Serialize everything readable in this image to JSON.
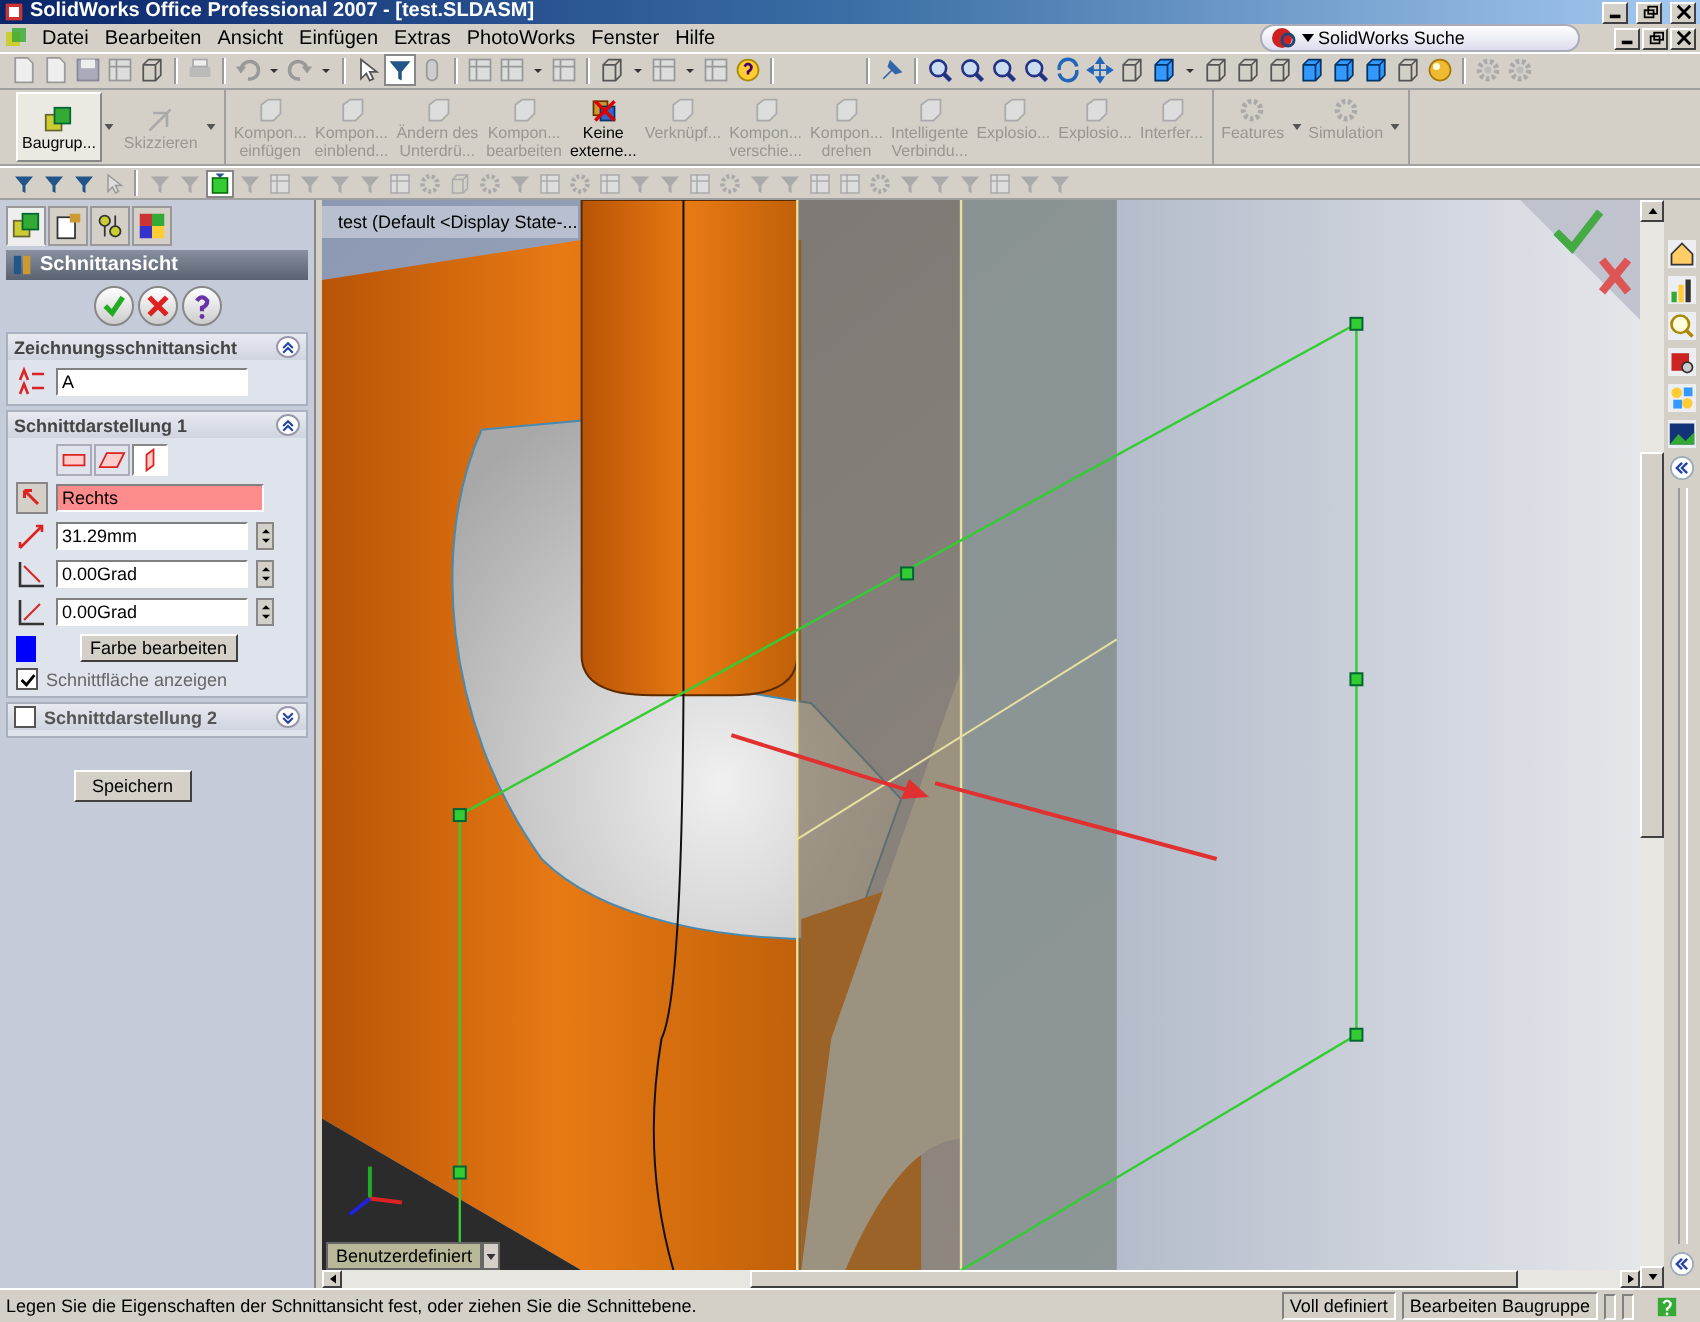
{
  "window": {
    "title": "SolidWorks Office Professional 2007 - [test.SLDASM]"
  },
  "menu": [
    "Datei",
    "Bearbeiten",
    "Ansicht",
    "Einfügen",
    "Extras",
    "PhotoWorks",
    "Fenster",
    "Hilfe"
  ],
  "search": {
    "placeholder": "SolidWorks Suche"
  },
  "command_manager": {
    "modes": [
      {
        "lines": [
          "Baugrup..."
        ],
        "disabled": false,
        "selected": true
      },
      {
        "lines": [
          "Skizzieren"
        ],
        "disabled": true,
        "selected": false
      }
    ],
    "tools": [
      {
        "lines": [
          "Kompon...",
          "einfügen"
        ],
        "disabled": true
      },
      {
        "lines": [
          "Kompon...",
          "einblend..."
        ],
        "disabled": true
      },
      {
        "lines": [
          "Ändern des",
          "Unterdrü..."
        ],
        "disabled": true
      },
      {
        "lines": [
          "Kompon...",
          "bearbeiten"
        ],
        "disabled": true
      },
      {
        "lines": [
          "Keine",
          "externe..."
        ],
        "disabled": false
      },
      {
        "lines": [
          "Verknüpf..."
        ],
        "disabled": true
      },
      {
        "lines": [
          "Kompon...",
          "verschie..."
        ],
        "disabled": true
      },
      {
        "lines": [
          "Kompon...",
          "drehen"
        ],
        "disabled": true
      },
      {
        "lines": [
          "Intelligente",
          "Verbindu..."
        ],
        "disabled": true
      },
      {
        "lines": [
          "Explosio..."
        ],
        "disabled": true
      },
      {
        "lines": [
          "Explosio..."
        ],
        "disabled": true
      },
      {
        "lines": [
          "Interfer..."
        ],
        "disabled": true
      }
    ],
    "extras": [
      {
        "lines": [
          "Features"
        ],
        "disabled": true
      },
      {
        "lines": [
          "Simulation"
        ],
        "disabled": true
      }
    ]
  },
  "panel_tabs": [
    {
      "selected": true
    },
    {
      "selected": false
    },
    {
      "selected": false
    },
    {
      "selected": false
    }
  ],
  "property_manager": {
    "title": "Schnittansicht",
    "drawing_section": {
      "title": "Zeichnungsschnittansicht",
      "value": "A"
    },
    "section_1": {
      "title": "Schnittdarstellung 1",
      "planes": [
        {
          "selected": false
        },
        {
          "selected": false
        },
        {
          "selected": true
        }
      ],
      "reference": "Rechts",
      "distance": "31.29mm",
      "angle_x": "0.00Grad",
      "angle_y": "0.00Grad",
      "color": "#0000ff",
      "color_button": "Farbe bearbeiten",
      "show_face": {
        "label": "Schnittfläche anzeigen",
        "checked": true
      }
    },
    "section_2": {
      "title": "Schnittdarstellung 2",
      "checked": false
    },
    "save_button": "Speichern"
  },
  "tree_flyout": {
    "label": "test  (Default <Display State-..."
  },
  "view_orientation": {
    "label": "Benutzerdefiniert"
  },
  "status_bar": {
    "message": "Legen Sie die Eigenschaften der Schnittansicht fest, oder ziehen Sie die Schnittebene.",
    "fields": [
      "Voll definiert",
      "Bearbeiten Baugruppe"
    ]
  }
}
